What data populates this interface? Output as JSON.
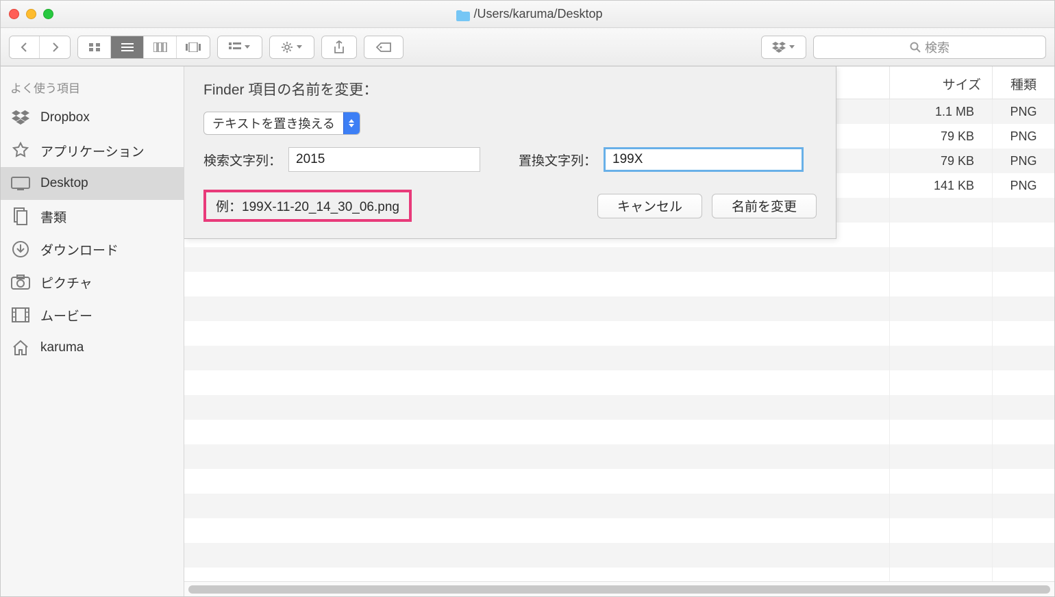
{
  "titlebar": {
    "path": "/Users/karuma/Desktop"
  },
  "toolbar": {
    "search_placeholder": "検索"
  },
  "sidebar": {
    "heading": "よく使う項目",
    "items": [
      {
        "label": "Dropbox"
      },
      {
        "label": "アプリケーション"
      },
      {
        "label": "Desktop"
      },
      {
        "label": "書類"
      },
      {
        "label": "ダウンロード"
      },
      {
        "label": "ピクチャ"
      },
      {
        "label": "ムービー"
      },
      {
        "label": "karuma"
      }
    ]
  },
  "columns": {
    "size": "サイズ",
    "kind": "種類"
  },
  "files": [
    {
      "size": "1.1 MB",
      "kind": "PNG"
    },
    {
      "size": "79 KB",
      "kind": "PNG"
    },
    {
      "size": "79 KB",
      "kind": "PNG"
    },
    {
      "size": "141 KB",
      "kind": "PNG"
    }
  ],
  "rename": {
    "title": "Finder 項目の名前を変更：",
    "mode": "テキストを置き換える",
    "find_label": "検索文字列：",
    "find_value": "2015",
    "replace_label": "置換文字列：",
    "replace_value": "199X",
    "example": "例：199X-11-20_14_30_06.png",
    "cancel": "キャンセル",
    "rename_btn": "名前を変更"
  }
}
